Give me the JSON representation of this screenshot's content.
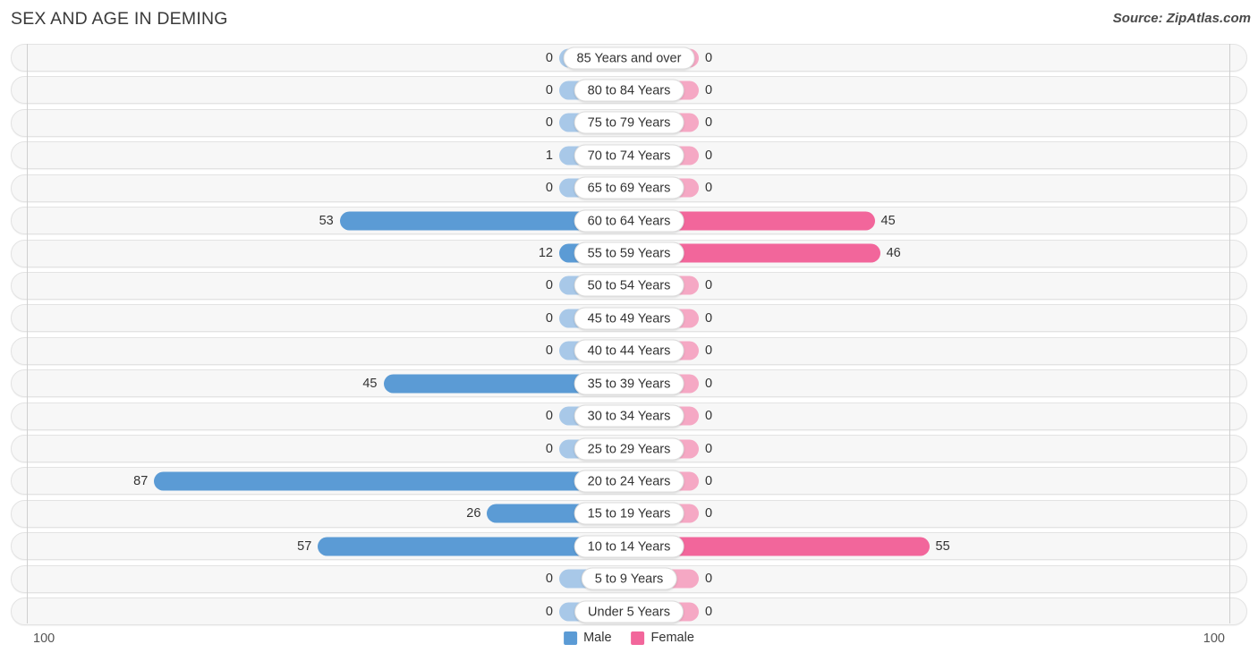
{
  "header": {
    "title": "SEX AND AGE IN DEMING",
    "source": "Source: ZipAtlas.com"
  },
  "legend": {
    "male_label": "Male",
    "female_label": "Female",
    "male_color": "#5b9bd5",
    "female_color": "#f2669b"
  },
  "axis": {
    "left_end_label": "100",
    "right_end_label": "100",
    "max": 100
  },
  "colors": {
    "male_strong": "#5b9bd5",
    "male_light": "#a8c8e8",
    "female_strong": "#f2669b",
    "female_light": "#f5a8c4",
    "row_track": "#f7f7f7",
    "row_border": "#e3e3e3"
  },
  "chart_data": {
    "type": "bar",
    "title": "SEX AND AGE IN DEMING",
    "subtitle": "Source: ZipAtlas.com",
    "orientation": "horizontal",
    "layout": "population-pyramid",
    "xlabel": "",
    "ylabel": "",
    "xlim": [
      100,
      100
    ],
    "grid": false,
    "legend_position": "bottom-center",
    "categories": [
      "85 Years and over",
      "80 to 84 Years",
      "75 to 79 Years",
      "70 to 74 Years",
      "65 to 69 Years",
      "60 to 64 Years",
      "55 to 59 Years",
      "50 to 54 Years",
      "45 to 49 Years",
      "40 to 44 Years",
      "35 to 39 Years",
      "30 to 34 Years",
      "25 to 29 Years",
      "20 to 24 Years",
      "15 to 19 Years",
      "10 to 14 Years",
      "5 to 9 Years",
      "Under 5 Years"
    ],
    "series": [
      {
        "name": "Male",
        "color": "#5b9bd5",
        "direction": "left",
        "values": [
          0,
          0,
          0,
          1,
          0,
          53,
          12,
          0,
          0,
          0,
          45,
          0,
          0,
          87,
          26,
          57,
          0,
          0
        ]
      },
      {
        "name": "Female",
        "color": "#f2669b",
        "direction": "right",
        "values": [
          0,
          0,
          0,
          0,
          0,
          45,
          46,
          0,
          0,
          0,
          0,
          0,
          0,
          0,
          0,
          55,
          0,
          0
        ]
      }
    ]
  }
}
